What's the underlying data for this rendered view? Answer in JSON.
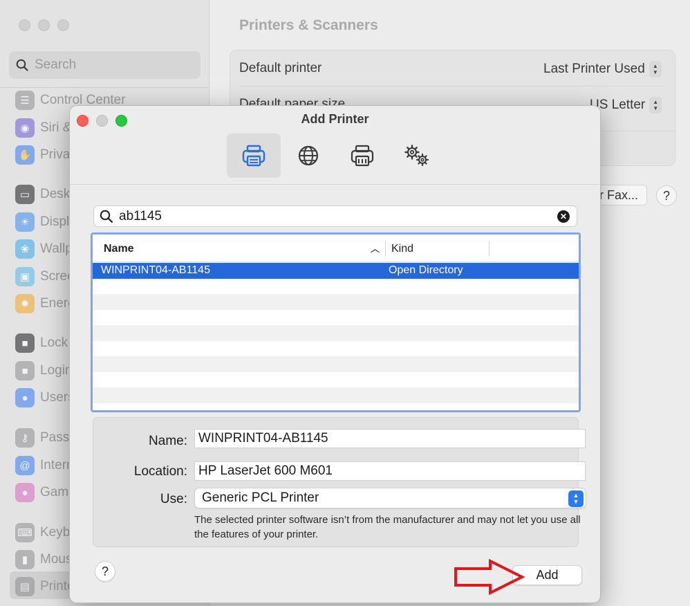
{
  "background": {
    "search_placeholder": "Search",
    "pane_title": "Printers & Scanners",
    "default_printer_label": "Default printer",
    "default_printer_value": "Last Printer Used",
    "default_paper_label": "Default paper size",
    "default_paper_value": "US Letter",
    "fax_button": "r Fax...",
    "help": "?",
    "sidebar": [
      {
        "label": "Control Center",
        "icon": "control-center-icon",
        "color": "#8e8e93"
      },
      {
        "label": "Siri &",
        "icon": "siri-icon",
        "color": "#6b5bd6"
      },
      {
        "label": "Priva",
        "icon": "privacy-hand-icon",
        "color": "#3478f6"
      },
      {
        "label": "Desk",
        "icon": "desktop-dock-icon",
        "color": "#1d1d1f"
      },
      {
        "label": "Displ",
        "icon": "displays-icon",
        "color": "#3b8cf5"
      },
      {
        "label": "Wallp",
        "icon": "wallpaper-icon",
        "color": "#37a8f0"
      },
      {
        "label": "Scree",
        "icon": "screen-saver-icon",
        "color": "#55b9e9"
      },
      {
        "label": "Energ",
        "icon": "energy-icon",
        "color": "#f4a623"
      },
      {
        "label": "Lock",
        "icon": "lock-screen-icon",
        "color": "#1d1d1f"
      },
      {
        "label": "Login",
        "icon": "login-password-icon",
        "color": "#8e8e93"
      },
      {
        "label": "Users",
        "icon": "users-groups-icon",
        "color": "#3478f6"
      },
      {
        "label": "Passw",
        "icon": "passwords-key-icon",
        "color": "#8e8e93"
      },
      {
        "label": "Intern",
        "icon": "internet-accounts-icon",
        "color": "#3478f6"
      },
      {
        "label": "Game",
        "icon": "game-center-icon",
        "color": "#d86ac2"
      },
      {
        "label": "Keyb",
        "icon": "keyboard-icon",
        "color": "#8e8e93"
      },
      {
        "label": "Mous",
        "icon": "mouse-icon",
        "color": "#8e8e93"
      },
      {
        "label": "Printe",
        "icon": "printers-icon",
        "color": "#8e8e93"
      }
    ]
  },
  "dialog": {
    "title": "Add Printer",
    "toolbar": [
      "default-printers-tab",
      "ip-printers-tab",
      "windows-printers-tab",
      "advanced-tab"
    ],
    "search_value": "ab1145",
    "table": {
      "columns": [
        "Name",
        "Kind"
      ],
      "rows": [
        {
          "name": "WINPRINT04-AB1145",
          "kind": "Open Directory",
          "selected": true
        }
      ]
    },
    "name_label": "Name:",
    "name_value": "WINPRINT04-AB1145",
    "location_label": "Location:",
    "location_value": "HP LaserJet 600 M601",
    "use_label": "Use:",
    "use_value": "Generic PCL Printer",
    "note": "The selected printer software isn’t from the manufacturer and may not let you use all the features of your printer.",
    "help": "?",
    "add_button": "Add"
  },
  "colors": {
    "selection": "#2566d8",
    "accent": "#2a7bf6",
    "annotation_arrow": "#e3161b"
  }
}
